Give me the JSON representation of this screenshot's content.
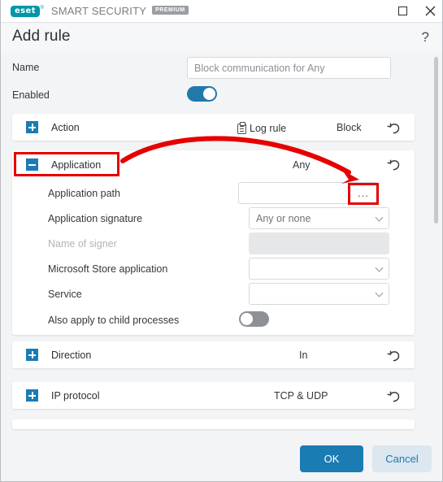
{
  "titlebar": {
    "brand_mark": "eset",
    "product_name": "SMART SECURITY",
    "edition_badge": "PREMIUM",
    "maximize_label": "Maximize",
    "close_label": "Close"
  },
  "header": {
    "title": "Add rule",
    "help_label": "?"
  },
  "form": {
    "name_label": "Name",
    "name_value": "Block communication for Any",
    "name_placeholder": "Block communication for Any",
    "enabled_label": "Enabled",
    "enabled_state": "on"
  },
  "sections": [
    {
      "id": "action",
      "label": "Action",
      "expanded": false,
      "toggle_icon": "plus-icon",
      "log_rule_label": "Log rule",
      "log_rule_icon": "clipboard-icon",
      "value": "Block",
      "reset_icon": "undo-icon"
    },
    {
      "id": "application",
      "label": "Application",
      "expanded": true,
      "toggle_icon": "minus-icon",
      "value": "Any",
      "reset_icon": "undo-icon",
      "fields": [
        {
          "id": "application-path",
          "label": "Application path",
          "value": "",
          "type": "text-with-browse",
          "browse_label": "...",
          "disabled": false
        },
        {
          "id": "application-signature",
          "label": "Application signature",
          "value": "Any or none",
          "type": "select",
          "disabled": false
        },
        {
          "id": "name-of-signer",
          "label": "Name of signer",
          "value": "",
          "type": "text",
          "disabled": true
        },
        {
          "id": "microsoft-store-application",
          "label": "Microsoft Store application",
          "value": "",
          "type": "select",
          "disabled": false
        },
        {
          "id": "service",
          "label": "Service",
          "value": "",
          "type": "select",
          "disabled": false
        },
        {
          "id": "child-processes",
          "label": "Also apply to child processes",
          "value": "off",
          "type": "toggle",
          "disabled": false
        }
      ]
    },
    {
      "id": "direction",
      "label": "Direction",
      "expanded": false,
      "toggle_icon": "plus-icon",
      "value": "In",
      "reset_icon": "undo-icon"
    },
    {
      "id": "ip-protocol",
      "label": "IP protocol",
      "expanded": false,
      "toggle_icon": "plus-icon",
      "value": "TCP & UDP",
      "reset_icon": "undo-icon"
    }
  ],
  "footer": {
    "ok_label": "OK",
    "cancel_label": "Cancel"
  },
  "annotations": {
    "highlight_color": "#e60000",
    "boxes": [
      "application-section-header",
      "application-path-browse-button"
    ],
    "arrow": "curved-arrow-from-application-header-to-browse-button"
  },
  "colors": {
    "accent": "#1b7bb3",
    "brand": "#0097a9",
    "toggle_on": "#2079ad",
    "toggle_off": "#8d9196",
    "annotation": "#e60000",
    "page_bg": "#f2f4f6"
  }
}
